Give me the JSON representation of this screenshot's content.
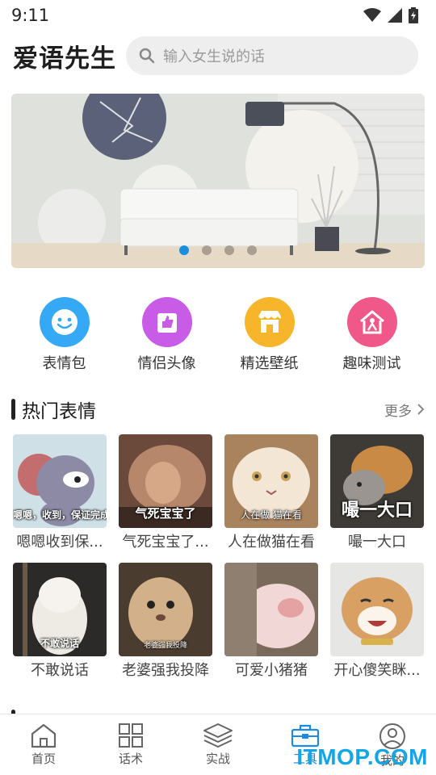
{
  "status_bar": {
    "time": "9:11"
  },
  "header": {
    "title": "爱语先生",
    "search_placeholder": "输入女生说的话"
  },
  "banner": {
    "dots": 4,
    "active_index": 0
  },
  "categories": [
    {
      "label": "表情包",
      "icon": "smile-icon",
      "color": "#35a9f5"
    },
    {
      "label": "情侣头像",
      "icon": "thumbs-up-icon",
      "color": "#c95ce6"
    },
    {
      "label": "精选壁纸",
      "icon": "store-icon",
      "color": "#f7b52c"
    },
    {
      "label": "趣味测试",
      "icon": "house-person-icon",
      "color": "#f0588a"
    }
  ],
  "section": {
    "title": "热门表情",
    "more": "更多"
  },
  "stickers": [
    {
      "title": "嗯嗯收到保...",
      "caption": "嗯嗯，收到，保证完成任务"
    },
    {
      "title": "气死宝宝了...",
      "caption": "气死宝宝了"
    },
    {
      "title": "人在做猫在看",
      "caption": "人在做 猫在看"
    },
    {
      "title": "嘬一大口",
      "caption": "嘬一大口"
    },
    {
      "title": "不敢说话",
      "caption": "不敢说话"
    },
    {
      "title": "老婆强我投降",
      "caption": "老婆强我投降"
    },
    {
      "title": "可爱小猪猪",
      "caption": ""
    },
    {
      "title": "开心傻笑眯...",
      "caption": ""
    }
  ],
  "bottom_nav": [
    {
      "label": "首页",
      "icon": "home-icon",
      "active": false
    },
    {
      "label": "话术",
      "icon": "grid-icon",
      "active": false
    },
    {
      "label": "实战",
      "icon": "layers-icon",
      "active": false
    },
    {
      "label": "工具",
      "icon": "toolbox-icon",
      "active": true
    },
    {
      "label": "我的",
      "icon": "profile-icon",
      "active": false
    }
  ],
  "watermark": "ITMOP.COM"
}
